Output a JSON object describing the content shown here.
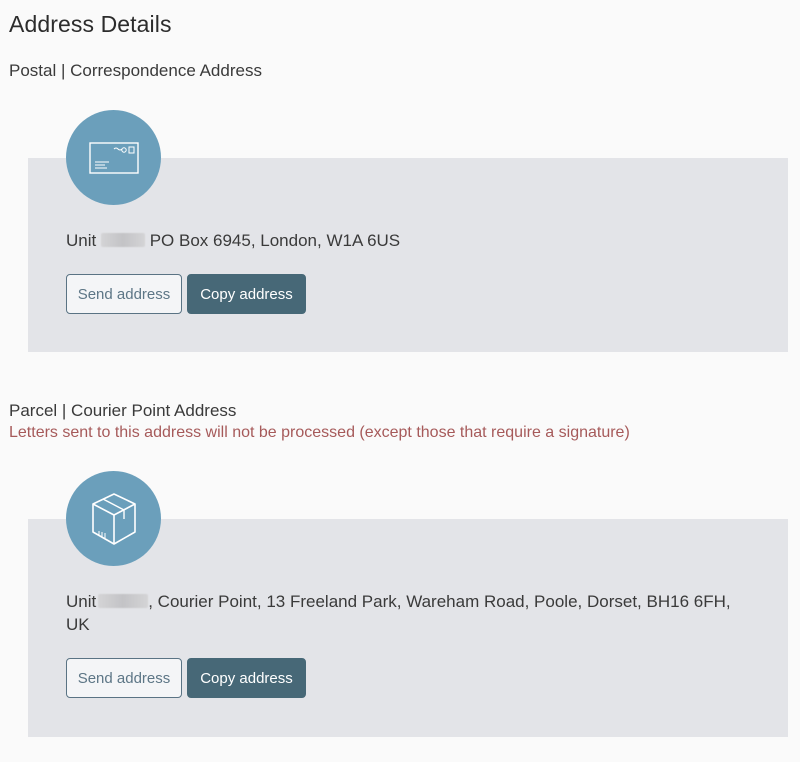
{
  "page": {
    "title": "Address Details"
  },
  "postal": {
    "heading": "Postal | Correspondence Address",
    "icon": "envelope-icon",
    "address_prefix": "Unit",
    "address_rest": "PO Box 6945, London, W1A 6US",
    "send_label": "Send address",
    "copy_label": "Copy address"
  },
  "parcel": {
    "heading": "Parcel | Courier Point Address",
    "warning": "Letters sent to this address will not be processed (except those that require a signature)",
    "icon": "parcel-box-icon",
    "address_prefix": "Unit",
    "address_rest": ", Courier Point, 13 Freeland Park, Wareham Road, Poole, Dorset, BH16 6FH, UK",
    "send_label": "Send address",
    "copy_label": "Copy address"
  },
  "colors": {
    "icon_circle": "#6b9fbb",
    "card_background": "#e3e4e8",
    "primary_button": "#476877",
    "warning_text": "#a65a5a"
  }
}
